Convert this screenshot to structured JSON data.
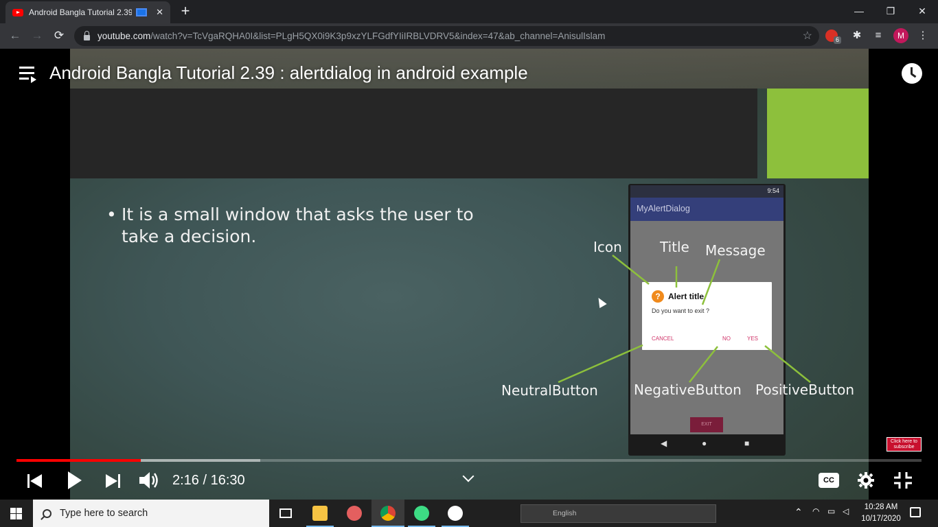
{
  "browser": {
    "tab_title": "Android Bangla Tutorial 2.39",
    "new_tab": "+",
    "tab_close": "✕",
    "window_controls": {
      "minimize": "—",
      "maximize": "❐",
      "close": "✕"
    },
    "nav": {
      "back": "←",
      "forward": "→",
      "reload": "⟳"
    },
    "url_host": "youtube.com",
    "url_path": "/watch?v=TcVgaRQHA0I&list=PLgH5QX0i9K3p9xzYLFGdfYIiIRBLVDRV5&index=47&ab_channel=AnisulIslam",
    "bookmark_icon": "☆",
    "extension_badge_count": "6",
    "extensions_icon": "✱",
    "media_icon": "≡",
    "avatar_letter": "M",
    "menu_icon": "⋮"
  },
  "player": {
    "video_title": "Android Bangla Tutorial 2.39 : alertdialog in android example",
    "current_time": "2:16",
    "duration": "16:30",
    "time_display": "2:16 / 16:30",
    "played_fraction": 0.137,
    "buffered_fraction": 0.269,
    "cc_label": "CC",
    "subscribe_label": "Click here to subscribe"
  },
  "slide": {
    "bullet": "It is a small window that asks the user to take a decision.",
    "phone": {
      "status_time": "9:54",
      "app_name": "MyAlertDialog",
      "dialog_title": "Alert title",
      "dialog_message": "Do you want to exit ?",
      "btn_cancel": "CANCEL",
      "btn_no": "NO",
      "btn_yes": "YES",
      "exit_button": "EXIT",
      "nav_back": "◀",
      "nav_home": "●",
      "nav_recent": "■"
    },
    "callouts": {
      "icon": "Icon",
      "title": "Title",
      "message": "Message",
      "neutral": "NeutralButton",
      "negative": "NegativeButton",
      "positive": "PositiveButton"
    }
  },
  "taskbar": {
    "search_placeholder": "Type here to search",
    "language": "English",
    "clock_time": "10:28 AM",
    "clock_date": "10/17/2020"
  },
  "colors": {
    "accent_green": "#8dc03c",
    "progress_red": "#ff0000",
    "dialog_button": "#d0356a",
    "app_bar": "#343f7a"
  }
}
